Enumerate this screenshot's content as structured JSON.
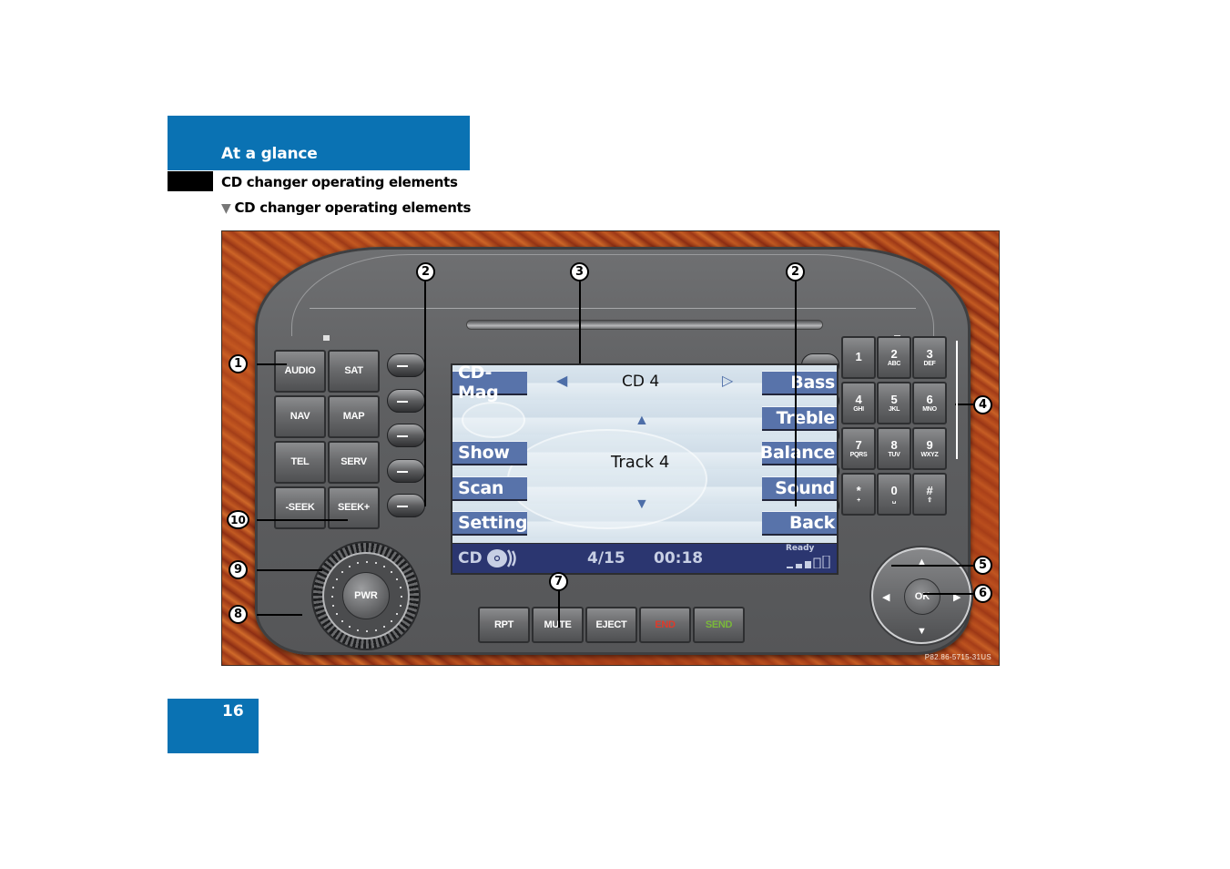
{
  "header": {
    "section": "At a glance",
    "subsection": "CD changer operating elements",
    "heading_marker": "▼",
    "heading": "CD changer operating elements"
  },
  "page_number": "16",
  "colors": {
    "brand_blue": "#0a72b3",
    "screen_button": "#5873aa",
    "status_bar": "#2b3670",
    "end_label": "#e03a2a",
    "send_label": "#7ab83a"
  },
  "figure": {
    "code": "P82.86-5715-31US",
    "left_keys": [
      "AUDIO",
      "SAT",
      "NAV",
      "MAP",
      "TEL",
      "SERV",
      "-SEEK",
      "SEEK+"
    ],
    "keypad": [
      {
        "main": "1",
        "sub": ""
      },
      {
        "main": "2",
        "sub": "ABC"
      },
      {
        "main": "3",
        "sub": "DEF"
      },
      {
        "main": "4",
        "sub": "GHI"
      },
      {
        "main": "5",
        "sub": "JKL"
      },
      {
        "main": "6",
        "sub": "MNO"
      },
      {
        "main": "7",
        "sub": "PQRS"
      },
      {
        "main": "8",
        "sub": "TUV"
      },
      {
        "main": "9",
        "sub": "WXYZ"
      },
      {
        "main": "*",
        "sub": "+"
      },
      {
        "main": "0",
        "sub": "␣"
      },
      {
        "main": "#",
        "sub": "⇧"
      }
    ],
    "bottom_keys": [
      "RPT",
      "MUTE",
      "EJECT",
      "END",
      "SEND"
    ],
    "knob_label": "PWR",
    "ok_label": "OK",
    "screen": {
      "left_buttons": [
        "CD-Mag",
        "",
        "Show",
        "Scan",
        "Setting"
      ],
      "right_buttons": [
        "Bass",
        "Treble",
        "Balance",
        "Sound",
        "Back"
      ],
      "cd_title": "CD 4",
      "track": "Track 4",
      "prev_icon": "◀",
      "next_icon": "▷",
      "up_icon": "▲",
      "down_icon": "▼",
      "status": {
        "source": "CD",
        "track_count": "4/15",
        "time": "00:18",
        "ready": "Ready",
        "signal_level": 3,
        "signal_max": 5
      }
    },
    "callouts": [
      "1",
      "2",
      "3",
      "2",
      "4",
      "5",
      "6",
      "7",
      "8",
      "9",
      "10"
    ]
  }
}
